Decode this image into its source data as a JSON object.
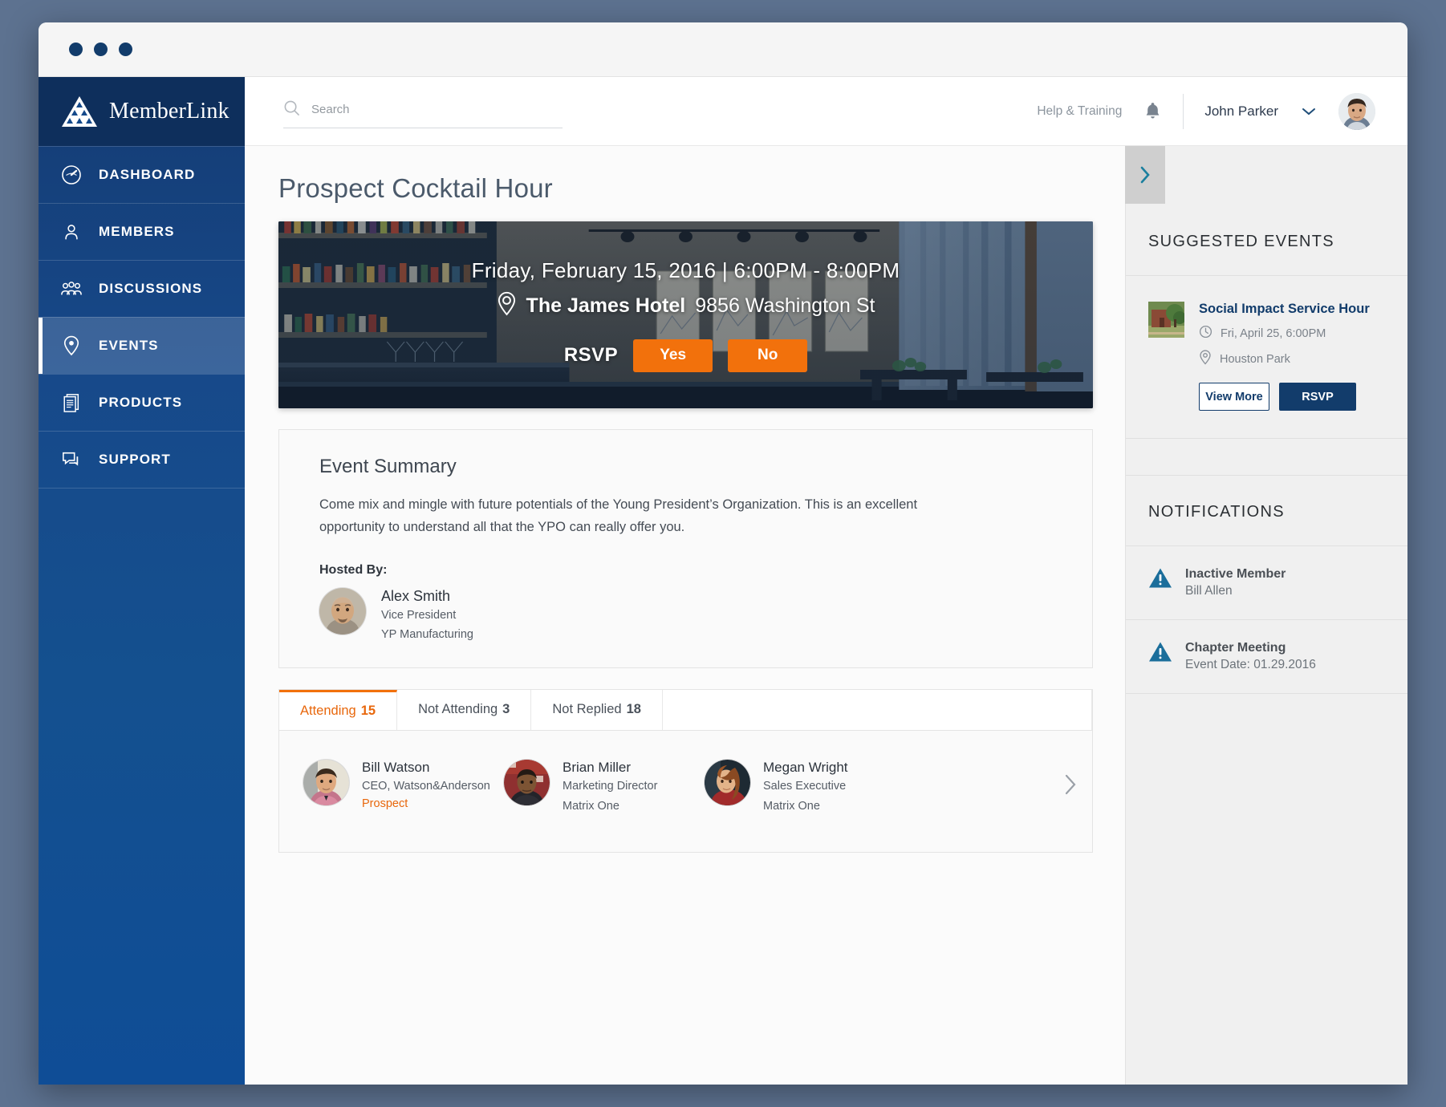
{
  "window": {
    "dots": [
      "close",
      "minimize",
      "maximize"
    ]
  },
  "brand": {
    "name": "MemberLink",
    "logo_icon": "triangle-logo-icon"
  },
  "sidebar": {
    "items": [
      {
        "label": "DASHBOARD",
        "icon": "gauge-icon",
        "active": false
      },
      {
        "label": "MEMBERS",
        "icon": "person-icon",
        "active": false
      },
      {
        "label": "DISCUSSIONS",
        "icon": "people-group-icon",
        "active": false
      },
      {
        "label": "EVENTS",
        "icon": "map-pin-icon",
        "active": true
      },
      {
        "label": "PRODUCTS",
        "icon": "documents-icon",
        "active": false
      },
      {
        "label": "SUPPORT",
        "icon": "chat-bubbles-icon",
        "active": false
      }
    ]
  },
  "topbar": {
    "search_placeholder": "Search",
    "search_value": "",
    "search_icon": "search-icon",
    "help_label": "Help & Training",
    "bell_icon": "bell-icon",
    "username": "John Parker",
    "chevron_icon": "chevron-down-icon",
    "avatar": "user-avatar"
  },
  "main": {
    "page_title": "Prospect Cocktail Hour",
    "hero": {
      "date_line": "Friday, February 15, 2016  |  6:00PM - 8:00PM",
      "pin_icon": "location-pin-icon",
      "venue_name": "The James Hotel",
      "venue_address": "9856 Washington St",
      "rsvp_label": "RSVP",
      "rsvp_yes": "Yes",
      "rsvp_no": "No"
    },
    "summary": {
      "title": "Event Summary",
      "body": "Come mix and mingle with future potentials of the Young President’s Organization. This is an excellent opportunity to understand all that the YPO can really offer you.",
      "hosted_by_label": "Hosted By:",
      "host": {
        "name": "Alex Smith",
        "title": "Vice President",
        "company": "YP Manufacturing"
      }
    },
    "tabs": [
      {
        "label": "Attending",
        "count": "15",
        "active": true
      },
      {
        "label": "Not Attending",
        "count": "3",
        "active": false
      },
      {
        "label": "Not Replied",
        "count": "18",
        "active": false
      }
    ],
    "attendees": [
      {
        "name": "Bill Watson",
        "title": "CEO, Watson&Anderson",
        "company": "",
        "tag": "Prospect"
      },
      {
        "name": "Brian Miller",
        "title": "Marketing Director",
        "company": "Matrix One",
        "tag": ""
      },
      {
        "name": "Megan Wright",
        "title": "Sales Executive",
        "company": "Matrix One",
        "tag": ""
      }
    ],
    "attendees_next_icon": "chevron-right-icon"
  },
  "rail": {
    "toggle_icon": "chevron-right-icon",
    "suggested_heading": "SUGGESTED EVENTS",
    "suggested_events": [
      {
        "title": "Social Impact Service Hour",
        "clock_icon": "clock-icon",
        "date": "Fri, April 25, 6:00PM",
        "pin_icon": "location-pin-icon",
        "location": "Houston Park",
        "view_more": "View More",
        "rsvp": "RSVP"
      }
    ],
    "notifications_heading": "NOTIFICATIONS",
    "notifications": [
      {
        "icon": "warning-icon",
        "title": "Inactive Member",
        "sub": "Bill Allen"
      },
      {
        "icon": "warning-icon",
        "title": "Chapter Meeting",
        "sub": "Event Date: 01.29.2016"
      }
    ]
  },
  "colors": {
    "navy": "#123c6b",
    "sidebar_blue": "#14498a",
    "orange": "#f2710c",
    "rail_bg": "#f0f0f0",
    "teal_chevron": "#1b7f9e"
  }
}
